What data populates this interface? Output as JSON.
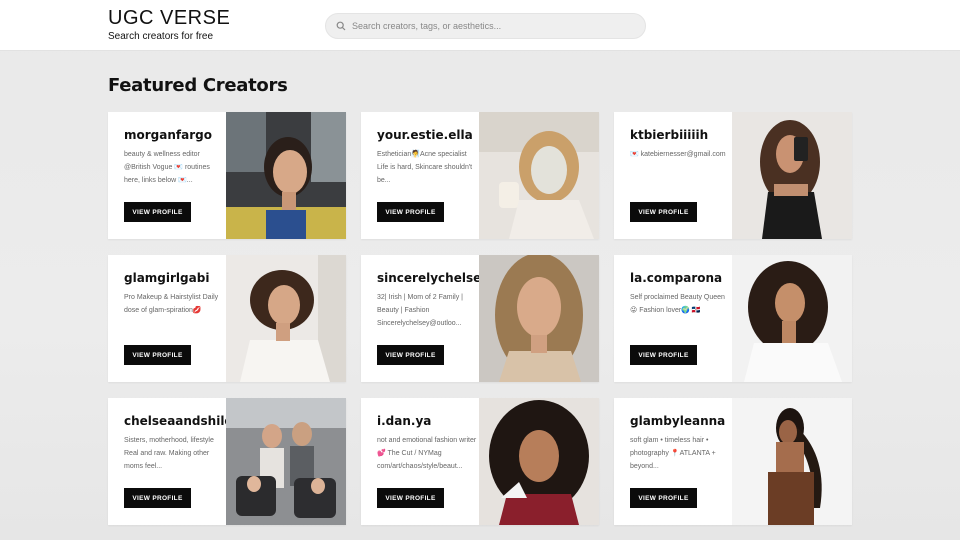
{
  "header": {
    "title": "UGC VERSE",
    "subtitle": "Search creators for free",
    "search_placeholder": "Search creators, tags, or aesthetics...",
    "search_icon": "search-icon"
  },
  "main": {
    "section_title": "Featured Creators",
    "button_label": "VIEW PROFILE",
    "creators": [
      {
        "handle": "morganfargo",
        "bio": "beauty & wellness editor @British Vogue 💌 routines here, links below 💌..."
      },
      {
        "handle": "your.estie.ella",
        "bio": "Esthetician🧖Acne specialist Life is hard, Skincare shouldn't be..."
      },
      {
        "handle": "ktbierbiiiiih",
        "bio": "💌 katebiernesser@gmail.com"
      },
      {
        "handle": "glamgirlgabi",
        "bio": "Pro Makeup & Hairstylist Daily dose of glam-spiration💋"
      },
      {
        "handle": "sincerelychelsey",
        "bio": "32| Irish | Mom of 2 Family | Beauty | Fashion Sincerelychelsey@outloo..."
      },
      {
        "handle": "la.comparona",
        "bio": "Self proclaimed Beauty Queen😜 Fashion lover🌍 🇩🇴"
      },
      {
        "handle": "chelseaandshiloh",
        "bio": "Sisters, motherhood, lifestyle Real and raw. Making other moms feel..."
      },
      {
        "handle": "i.dan.ya",
        "bio": "not and emotional fashion writer 💕 The Cut / NYMag com/art/chaos/style/beaut..."
      },
      {
        "handle": "glambyleanna",
        "bio": "soft glam • timeless hair • photography 📍ATLANTA + beyond..."
      }
    ]
  },
  "colors": {
    "button_bg": "#0b0b0b",
    "card_bg": "#ffffff",
    "page_bg": "#e9e9e9"
  }
}
